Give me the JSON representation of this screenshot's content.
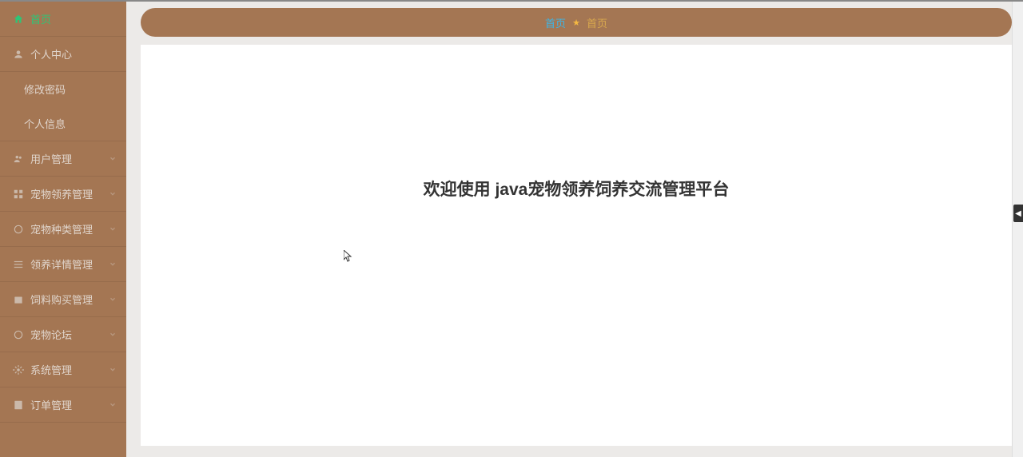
{
  "sidebar": {
    "items": [
      {
        "label": "首页",
        "icon": "home",
        "active": true,
        "expandable": false
      },
      {
        "label": "个人中心",
        "icon": "user",
        "active": false,
        "expandable": false
      },
      {
        "label": "修改密码",
        "icon": "",
        "active": false,
        "sub": true
      },
      {
        "label": "个人信息",
        "icon": "",
        "active": false,
        "sub": true
      },
      {
        "label": "用户管理",
        "icon": "users",
        "active": false,
        "expandable": true
      },
      {
        "label": "宠物领养管理",
        "icon": "grid",
        "active": false,
        "expandable": true
      },
      {
        "label": "宠物种类管理",
        "icon": "circle",
        "active": false,
        "expandable": true
      },
      {
        "label": "领养详情管理",
        "icon": "list",
        "active": false,
        "expandable": true
      },
      {
        "label": "饲料购买管理",
        "icon": "box",
        "active": false,
        "expandable": true
      },
      {
        "label": "宠物论坛",
        "icon": "chat",
        "active": false,
        "expandable": true
      },
      {
        "label": "系统管理",
        "icon": "gear",
        "active": false,
        "expandable": true
      },
      {
        "label": "订单管理",
        "icon": "order",
        "active": false,
        "expandable": true
      }
    ]
  },
  "breadcrumb": {
    "left": "首页",
    "right": "首页"
  },
  "main": {
    "welcome": "欢迎使用 java宠物领养饲养交流管理平台"
  }
}
